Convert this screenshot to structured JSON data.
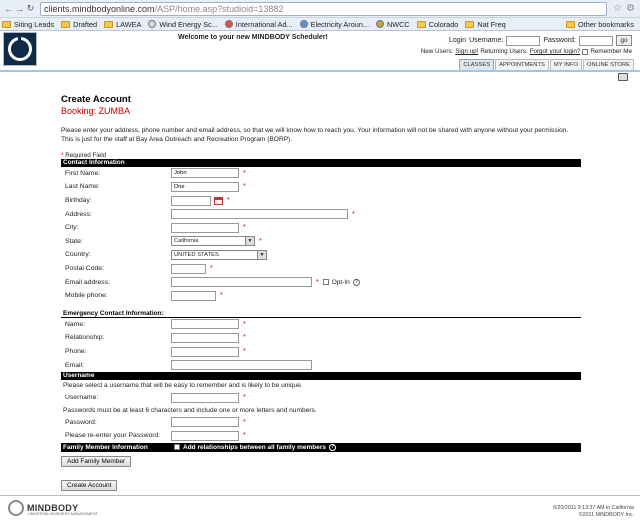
{
  "browser": {
    "url_host": "clients.mindbodyonline.com",
    "url_path": "/ASP/home.asp?studioid=13882",
    "bookmarks": [
      {
        "label": "Siting Leads",
        "kind": "folder"
      },
      {
        "label": "Drafted",
        "kind": "folder"
      },
      {
        "label": "LAWEA",
        "kind": "folder"
      },
      {
        "label": "Wind Energy Sc...",
        "kind": "site",
        "color": "#d9d9d9"
      },
      {
        "label": "International Ad...",
        "kind": "site",
        "color": "#e05050"
      },
      {
        "label": "Electricity Aroun...",
        "kind": "site",
        "color": "#5a8fd6"
      },
      {
        "label": "NWCC",
        "kind": "site",
        "color": "#c8a040"
      },
      {
        "label": "Colorado",
        "kind": "folder"
      },
      {
        "label": "Nat Freq",
        "kind": "folder"
      }
    ],
    "other_bookmarks": "Other bookmarks"
  },
  "header": {
    "welcome": "Welcome to your new MINDBODY Scheduler!",
    "login_label": "Login",
    "username_label": "Username:",
    "password_label": "Password:",
    "go_label": "go",
    "new_users_text": "New Users:",
    "sign_up": "Sign up!",
    "returning_text": "Returning Users:",
    "forgot": "Forgot your login?",
    "remember_me": "Remember Me",
    "tabs": [
      "CLASSES",
      "APPOINTMENTS",
      "MY INFO",
      "ONLINE STORE"
    ]
  },
  "page": {
    "title": "Create Account",
    "booking": "Booking: ZUMBA",
    "intro": "Please enter your address, phone number and email address, so that we will know how to reach you. Your information will not be shared with anyone without your permission. This is just for the staff at Bay Area Outreach and Recreation Program (BORP).",
    "required_note": "Required Field"
  },
  "contact": {
    "section": "Contact Information",
    "first_name": {
      "label": "First Name:",
      "value": "John"
    },
    "last_name": {
      "label": "Last Name:",
      "value": "Doe"
    },
    "birthday": {
      "label": "Birthday:"
    },
    "address": {
      "label": "Address:"
    },
    "city": {
      "label": "City:"
    },
    "state": {
      "label": "State:",
      "value": "California"
    },
    "country": {
      "label": "Country:",
      "value": "UNITED STATES"
    },
    "postal": {
      "label": "Postal Code:"
    },
    "email": {
      "label": "Email address:",
      "opt_in": "Opt-In"
    },
    "mobile": {
      "label": "Mobile phone:"
    }
  },
  "emergency": {
    "section": "Emergency Contact Information:",
    "name": "Name:",
    "relationship": "Relationship:",
    "phone": "Phone:",
    "email": "Email:"
  },
  "username": {
    "section": "Username",
    "hint": "Please select a username that will be easy to remember and is likely to be unique.",
    "username_label": "Username:",
    "password_hint": "Passwords must be at least 6 characters and include one or more letters and numbers.",
    "password_label": "Password:",
    "reenter_label": "Please re-enter your Password:"
  },
  "family": {
    "section": "Family Member Information",
    "add_relationships": "Add relationships between all family members",
    "add_button": "Add Family Member"
  },
  "create_button": "Create Account",
  "footer": {
    "logo_text": "MINDBODY",
    "logo_sub": "UNIVERSAL BUSINESS MANAGEMENT",
    "timestamp": "6/20/2011 9:13:37 AM in California",
    "copyright": "©2011 MINDBODY Inc."
  },
  "colors": {
    "accent_red": "#c00000",
    "section_black": "#000000",
    "tab_rule_blue": "#a7c4de"
  }
}
